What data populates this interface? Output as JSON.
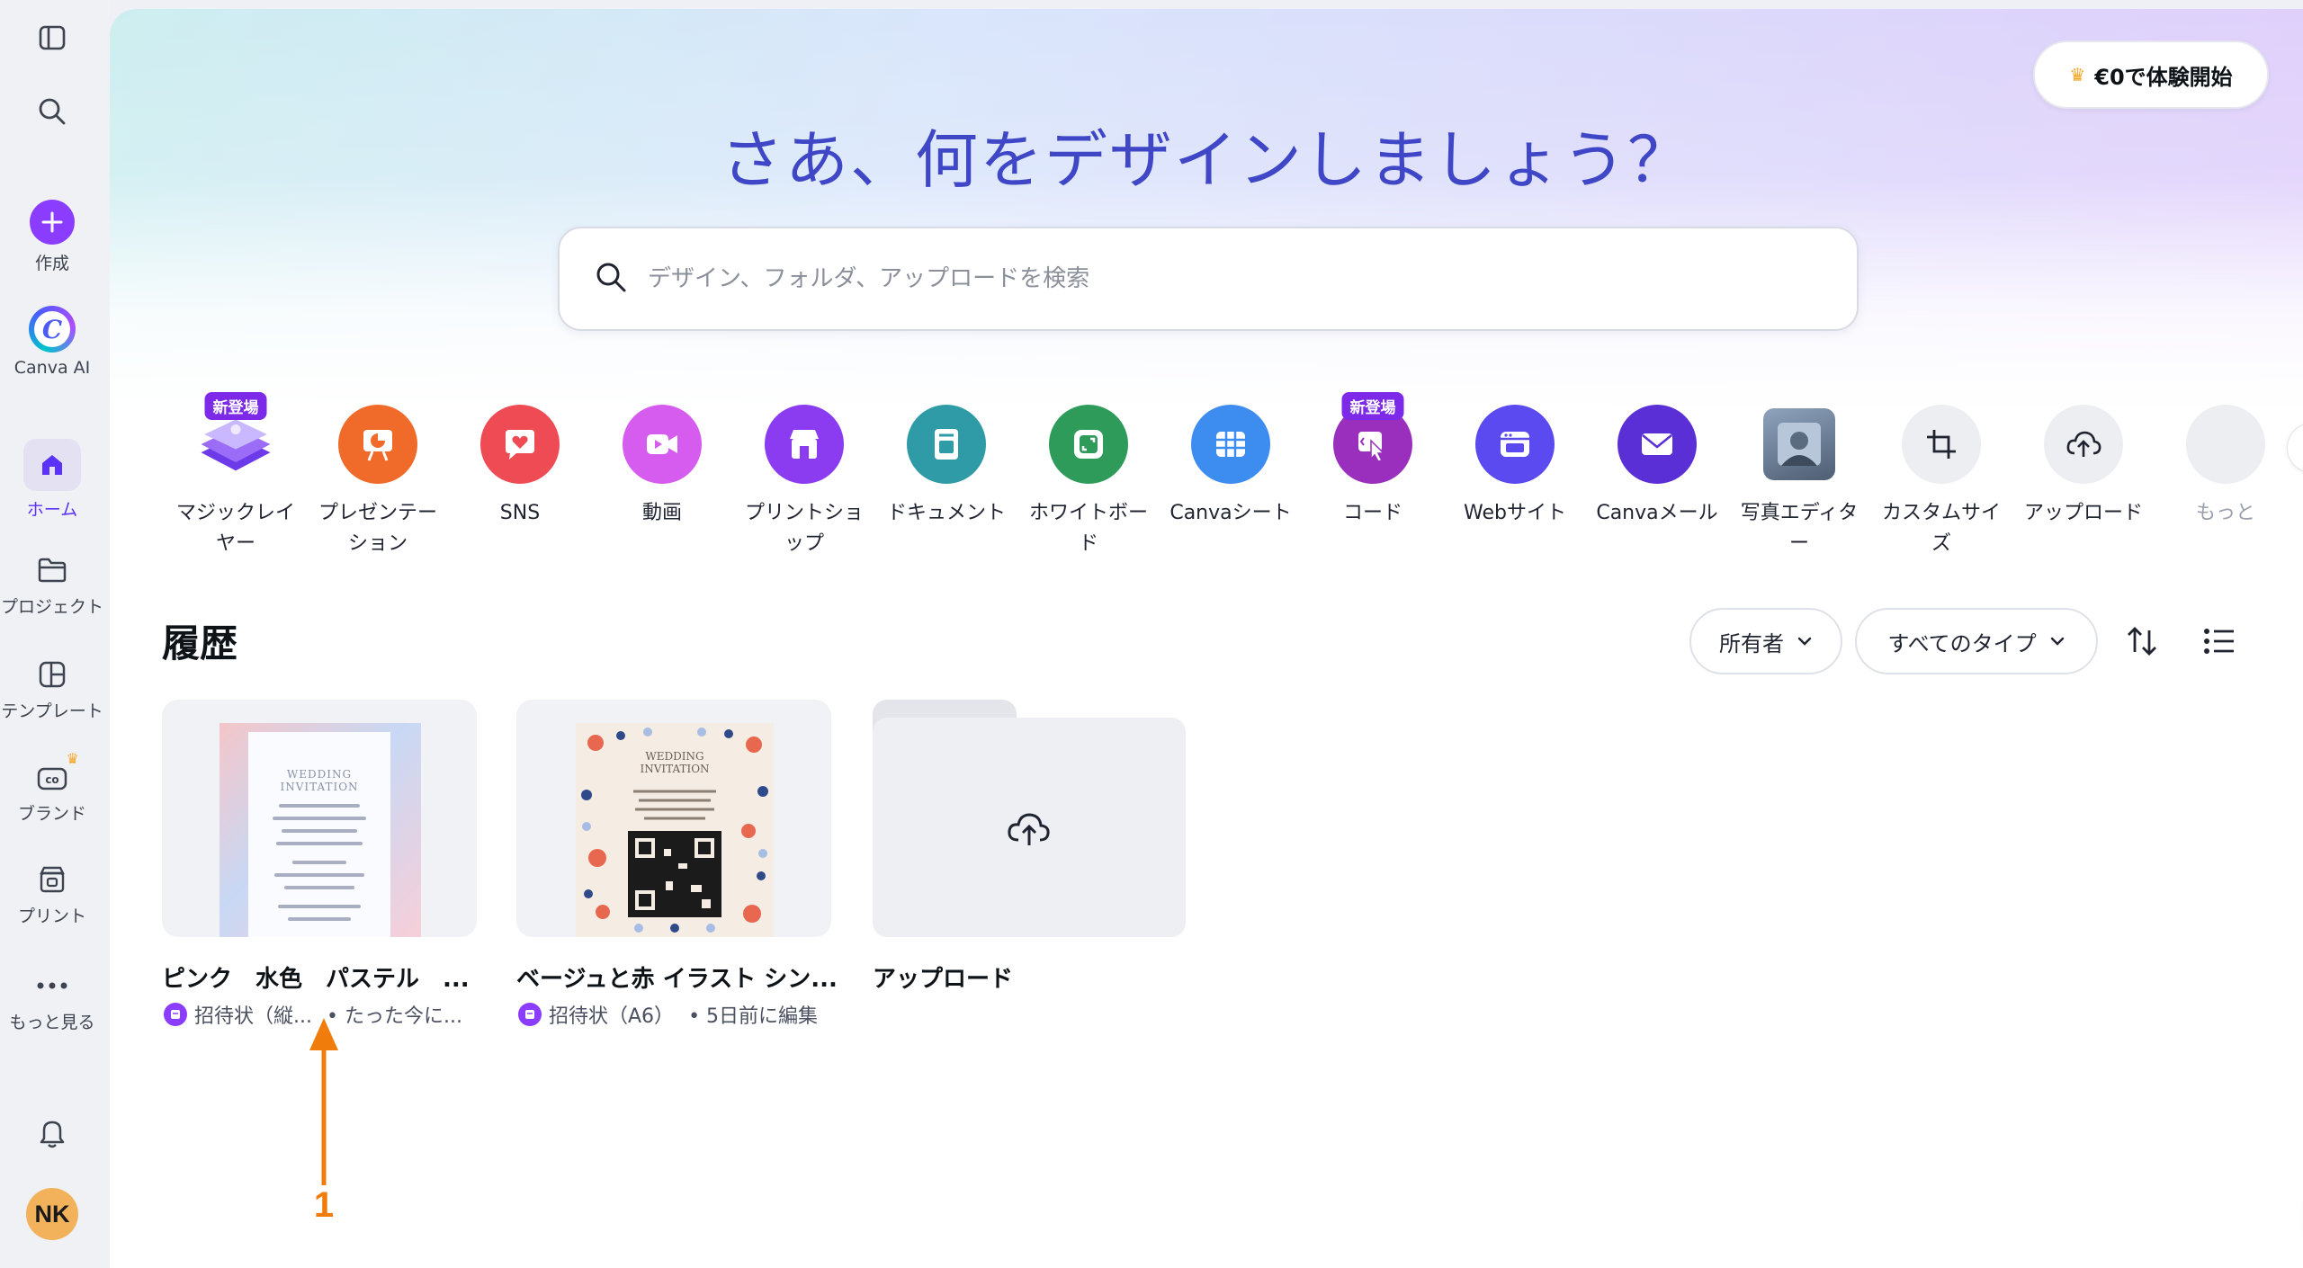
{
  "sidebar": {
    "create_label": "作成",
    "ai_label": "Canva AI",
    "home_label": "ホーム",
    "projects_label": "プロジェクト",
    "templates_label": "テンプレート",
    "brand_label": "ブランド",
    "print_label": "プリント",
    "more_label": "もっと見る",
    "avatar_initials": "NK"
  },
  "header": {
    "trial_button": "€0で体験開始",
    "headline": "さあ、何をデザインしましょう？"
  },
  "search": {
    "placeholder": "デザイン、フォルダ、アップロードを検索"
  },
  "categories": [
    {
      "label": "マジックレイヤー",
      "icon": "magic-layers-icon",
      "color": "#7b4bf0",
      "badge": "新登場"
    },
    {
      "label": "プレゼンテーション",
      "icon": "presentation-icon",
      "color": "#f06a2a"
    },
    {
      "label": "SNS",
      "icon": "heart-chat-icon",
      "color": "#ef4b55"
    },
    {
      "label": "動画",
      "icon": "video-icon",
      "color": "#d65cf0"
    },
    {
      "label": "プリントショップ",
      "icon": "shop-icon",
      "color": "#8b3bf0"
    },
    {
      "label": "ドキュメント",
      "icon": "document-icon",
      "color": "#2f9ba6"
    },
    {
      "label": "ホワイトボード",
      "icon": "whiteboard-icon",
      "color": "#2f9b5a"
    },
    {
      "label": "Canvaシート",
      "icon": "sheet-icon",
      "color": "#3d8cf0"
    },
    {
      "label": "コード",
      "icon": "code-icon",
      "color": "#9a2fbd",
      "badge": "新登場"
    },
    {
      "label": "Webサイト",
      "icon": "website-icon",
      "color": "#5a4af0"
    },
    {
      "label": "Canvaメール",
      "icon": "mail-icon",
      "color": "#5b2fd6"
    },
    {
      "label": "写真エディター",
      "icon": "photo-editor-icon",
      "color": "#6a7f9a"
    },
    {
      "label": "カスタムサイズ",
      "icon": "custom-size-icon",
      "color": "#eceef2"
    },
    {
      "label": "アップロード",
      "icon": "upload-cloud-icon",
      "color": "#eceef2"
    },
    {
      "label": "もっと",
      "icon": "more-icon",
      "color": "#eceef2"
    }
  ],
  "history": {
    "title": "履歴",
    "owner_filter": "所有者",
    "type_filter": "すべてのタイプ",
    "items": [
      {
        "title": "ピンク　水色　パステル　...",
        "type": "招待状（縦...",
        "time": "• たった今に..."
      },
      {
        "title": "ベージュと赤 イラスト シン...",
        "type": "招待状（A6）",
        "time": "• 5日前に編集"
      },
      {
        "title": "アップロード"
      }
    ]
  },
  "invite": {
    "heading1": "WEDDING",
    "heading2": "INVITATION"
  },
  "annotation": {
    "number": "1",
    "color": "#f07c0c"
  },
  "colors": {
    "accent": "#8b3dff",
    "headline": "#3f47c7"
  }
}
